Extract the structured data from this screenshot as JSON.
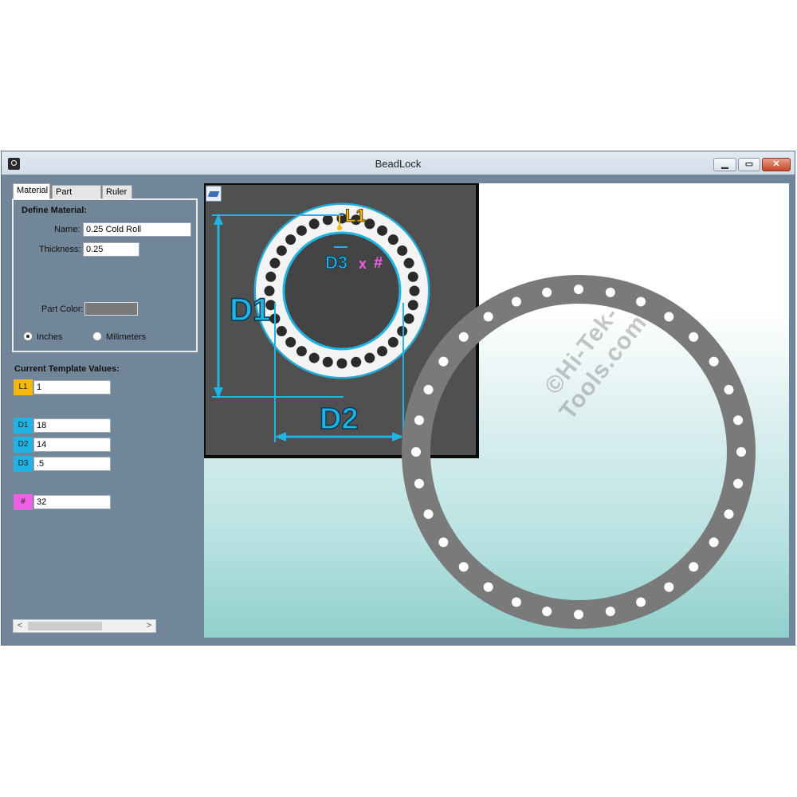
{
  "window": {
    "title": "BeadLock"
  },
  "tabs": [
    {
      "label": "Material"
    },
    {
      "label": "Part Details"
    },
    {
      "label": "Ruler"
    }
  ],
  "material": {
    "heading": "Define Material:",
    "name_label": "Name:",
    "name_value": "0.25 Cold Roll",
    "thickness_label": "Thickness:",
    "thickness_value": "0.25",
    "color_label": "Part Color:",
    "part_color": "#7a7a7a",
    "units": {
      "inches": "Inches",
      "millimeters": "Milimeters",
      "selected": "Inches"
    }
  },
  "template": {
    "heading": "Current Template Values:",
    "fields": [
      {
        "tag": "L1",
        "value": "1",
        "color": "#f5b80f"
      },
      {
        "tag": "D1",
        "value": "18",
        "color": "#1fb4e4"
      },
      {
        "tag": "D2",
        "value": "14",
        "color": "#1fb4e4"
      },
      {
        "tag": "D3",
        "value": ".5",
        "color": "#1fb4e4"
      },
      {
        "tag": "#",
        "value": "32",
        "color": "#ee5fe3"
      }
    ]
  },
  "preview_labels": {
    "l1": "L1",
    "d1": "D1",
    "d2": "D2",
    "d3": "D3",
    "x": "x",
    "count": "#"
  },
  "watermark": "©Hi-Tek-Tools.com",
  "colors": {
    "accent": "#1fb4e4",
    "l1": "#f5b80f",
    "count": "#ee5fe3",
    "part": "#7a7a7a"
  }
}
